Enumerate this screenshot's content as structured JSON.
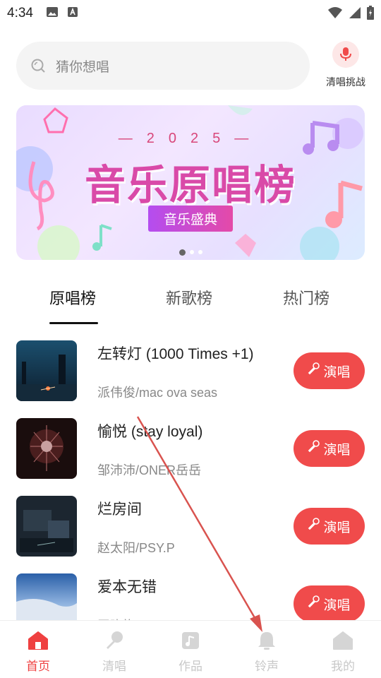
{
  "status_bar": {
    "time": "4:34",
    "icons": [
      "image-icon",
      "text-a-icon",
      "wifi-icon",
      "signal-icon",
      "battery-icon"
    ]
  },
  "search": {
    "placeholder": "猜你想唱"
  },
  "challenge": {
    "label": "清唱挑战",
    "icon": "microphone-icon"
  },
  "banner": {
    "year": "—2025—",
    "title": "音乐原唱榜",
    "subtitle": "音乐盛典",
    "slide_count": 3,
    "active_slide": 1
  },
  "tabs": [
    {
      "label": "原唱榜",
      "active": true
    },
    {
      "label": "新歌榜",
      "active": false
    },
    {
      "label": "热门榜",
      "active": false
    }
  ],
  "songs": [
    {
      "title": "左转灯 (1000 Times +1)",
      "artist": "派伟俊/mac ova seas",
      "button": "演唱"
    },
    {
      "title": "愉悦 (stay loyal)",
      "artist": "邹沛沛/ONER岳岳",
      "button": "演唱"
    },
    {
      "title": "烂房间",
      "artist": "赵太阳/PSY.P",
      "button": "演唱"
    },
    {
      "title": "爱本无错",
      "artist": "王晓旗",
      "button": "演唱"
    }
  ],
  "bottom_nav": [
    {
      "label": "首页",
      "icon": "home-icon",
      "active": true
    },
    {
      "label": "清唱",
      "icon": "microphone-icon",
      "active": false
    },
    {
      "label": "作品",
      "icon": "music-note-icon",
      "active": false
    },
    {
      "label": "铃声",
      "icon": "bell-icon",
      "active": false
    },
    {
      "label": "我的",
      "icon": "profile-home-icon",
      "active": false
    }
  ],
  "colors": {
    "accent": "#f04b4b",
    "nav_active": "#ef4040",
    "nav_inactive": "#c8c8c8",
    "annotation_arrow": "#d9534f"
  }
}
